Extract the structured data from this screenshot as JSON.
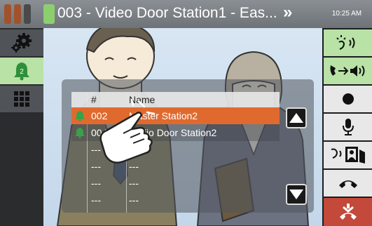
{
  "titlebar": {
    "title": "003 - Video Door Station1 - Eas...",
    "more_icon": "double-chevron-right",
    "time": "10:25 AM",
    "status_colors": [
      "#a0522d",
      "#a0522d",
      "#4a4a4a",
      "#8ccf6e"
    ]
  },
  "left_toolbar": {
    "items": [
      {
        "name": "settings",
        "icon": "gear-icon"
      },
      {
        "name": "notification",
        "icon": "bell-icon",
        "badge": "2"
      },
      {
        "name": "keypad",
        "icon": "keypad-icon"
      }
    ]
  },
  "right_toolbar": {
    "items": [
      {
        "name": "talk-mode",
        "icon": "voice-icon"
      },
      {
        "name": "transfer",
        "icon": "transfer-speaker-icon"
      },
      {
        "name": "record",
        "icon": "record-icon"
      },
      {
        "name": "mic",
        "icon": "microphone-icon"
      },
      {
        "name": "door-release",
        "icon": "door-release-icon"
      },
      {
        "name": "answer",
        "icon": "handset-icon"
      },
      {
        "name": "end",
        "icon": "hang-up-icon"
      }
    ],
    "colors": {
      "active": "#b9e2a6",
      "neutral": "#e8e8e8",
      "end": "#c3493a"
    }
  },
  "station_list": {
    "headers": {
      "icon": "",
      "number": "#",
      "name": "Name"
    },
    "rows": [
      {
        "number": "002",
        "name": "Master Station2",
        "selected": true,
        "icon": "bell-icon"
      },
      {
        "number": "004",
        "name": "Audio Door Station2",
        "selected": false,
        "icon": "bell-icon"
      },
      {
        "number": "---",
        "name": "---"
      },
      {
        "number": "---",
        "name": "---"
      },
      {
        "number": "---",
        "name": "---"
      },
      {
        "number": "---",
        "name": "---"
      }
    ],
    "selected_color": "#e06a2e"
  }
}
